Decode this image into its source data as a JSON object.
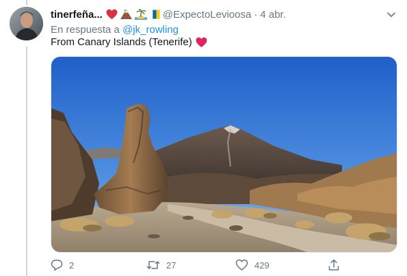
{
  "tweet": {
    "display_name": "tinerfeña...",
    "handle": "@ExpectoLevioosa",
    "separator": "·",
    "timestamp": "4 abr.",
    "name_emojis": [
      "red-heart",
      "volcano",
      "desert-island",
      "canary-islands-flag"
    ],
    "reply_prefix": "En respuesta a",
    "reply_to": "@jk_rowling",
    "text": "From Canary Islands (Tenerife)",
    "text_emoji": "red-heart",
    "media_description_icon": "photo-teide-volcano"
  },
  "actions": {
    "reply_count": "2",
    "retweet_count": "27",
    "like_count": "429"
  },
  "colors": {
    "link": "#1b95e0",
    "secondary_text": "#657786",
    "primary_text": "#14171a",
    "heart": "#e0245e",
    "thread_line": "#ccd6dd"
  }
}
